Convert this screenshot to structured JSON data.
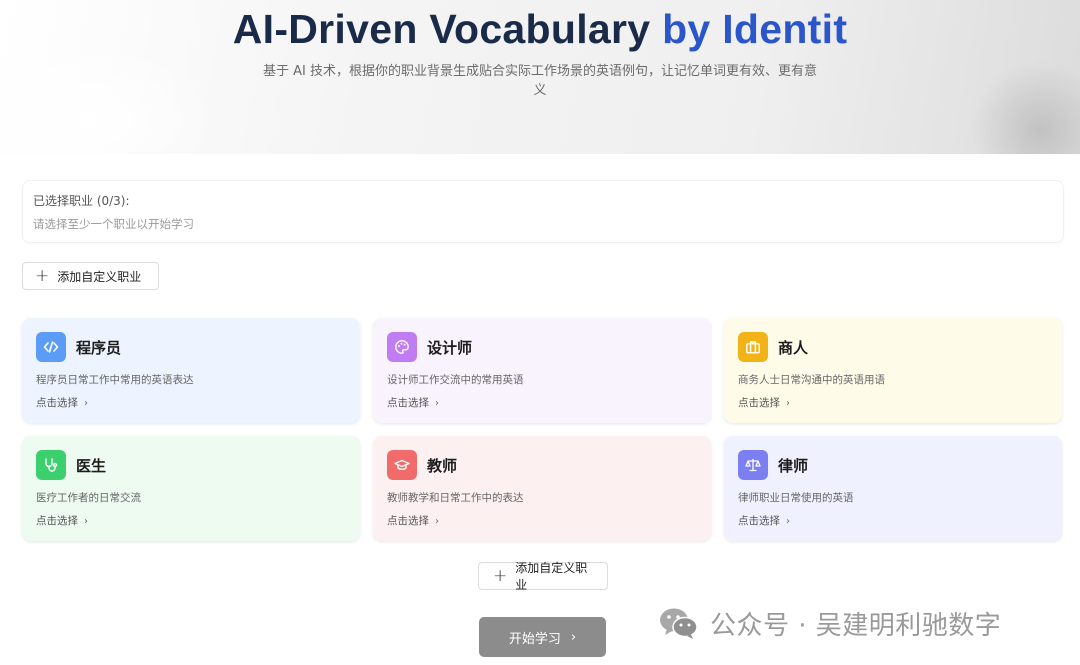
{
  "hero": {
    "title_part1": "AI-Driven Vocabulary ",
    "title_part2": "by Identit",
    "subtitle": "基于 AI 技术，根据你的职业背景生成贴合实际工作场景的英语例句，让记忆单词更有效、更有意义"
  },
  "selection": {
    "label": "已选择职业 (0/3):",
    "hint": "请选择至少一个职业以开始学习"
  },
  "add_custom_label": "添加自定义职业",
  "cards": [
    {
      "title": "程序员",
      "desc": "程序员日常工作中常用的英语表达",
      "action": "点击选择",
      "icon": "code-icon",
      "bg": "#eef4ff",
      "icon_bg": "#5b9cf6"
    },
    {
      "title": "设计师",
      "desc": "设计师工作交流中的常用英语",
      "action": "点击选择",
      "icon": "palette-icon",
      "bg": "#f8f3fd",
      "icon_bg": "#c07cf3"
    },
    {
      "title": "商人",
      "desc": "商务人士日常沟通中的英语用语",
      "action": "点击选择",
      "icon": "briefcase-icon",
      "bg": "#fefbe9",
      "icon_bg": "#f2b318"
    },
    {
      "title": "医生",
      "desc": "医疗工作者的日常交流",
      "action": "点击选择",
      "icon": "stethoscope-icon",
      "bg": "#edfbf1",
      "icon_bg": "#3ccf6d"
    },
    {
      "title": "教师",
      "desc": "教师教学和日常工作中的表达",
      "action": "点击选择",
      "icon": "graduation-cap-icon",
      "bg": "#fdf0f0",
      "icon_bg": "#f26b6b"
    },
    {
      "title": "律师",
      "desc": "律师职业日常使用的英语",
      "action": "点击选择",
      "icon": "scale-icon",
      "bg": "#eff1fe",
      "icon_bg": "#7b7ff2"
    }
  ],
  "start_button": {
    "label": "开始学习"
  },
  "watermark": {
    "text": "公众号 · 吴建明利驰数字"
  }
}
